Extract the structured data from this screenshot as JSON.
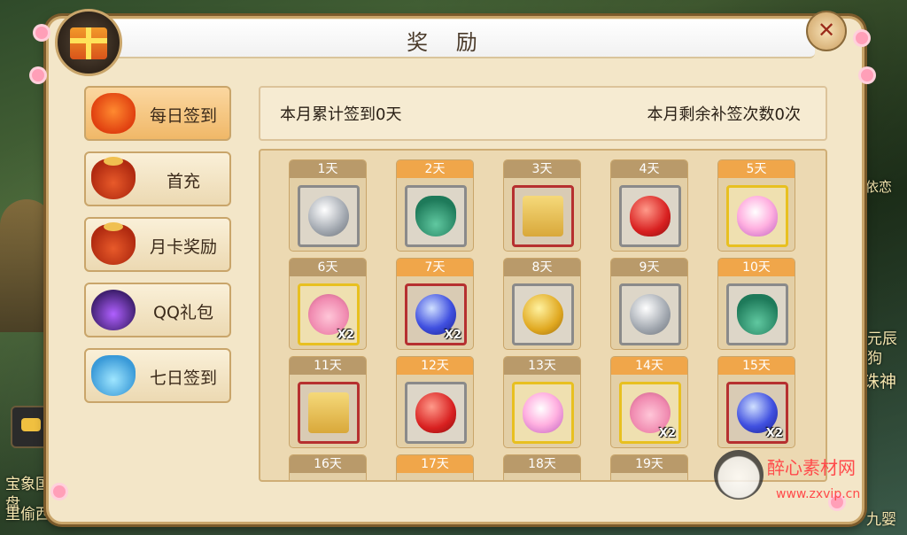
{
  "panel": {
    "title": "奖 励",
    "close_icon": "close-x-icon"
  },
  "tabs": [
    {
      "label": "每日签到",
      "icon": "red-envelope-icon",
      "active": true
    },
    {
      "label": "首充",
      "icon": "lucky-bag-icon",
      "active": false
    },
    {
      "label": "月卡奖励",
      "icon": "lucky-bag-icon",
      "active": false
    },
    {
      "label": "QQ礼包",
      "icon": "qq-gift-icon",
      "active": false
    },
    {
      "label": "七日签到",
      "icon": "blue-bag-icon",
      "active": false
    }
  ],
  "info": {
    "cumulative": "本月累计签到0天",
    "makeup_remaining": "本月剩余补签次数0次"
  },
  "days": [
    {
      "label": "1天",
      "item": "silver-coin-icon",
      "frame": "gray",
      "qty": "",
      "highlight": false
    },
    {
      "label": "2天",
      "item": "jade-leaf-icon",
      "frame": "gray",
      "qty": "",
      "highlight": true
    },
    {
      "label": "3天",
      "item": "scroll-icon",
      "frame": "red",
      "qty": "",
      "highlight": false
    },
    {
      "label": "4天",
      "item": "red-gem-icon",
      "frame": "gray",
      "qty": "",
      "highlight": false
    },
    {
      "label": "5天",
      "item": "pet-egg-icon",
      "frame": "yellow",
      "qty": "",
      "highlight": true
    },
    {
      "label": "6天",
      "item": "piggy-bag-icon",
      "frame": "yellow",
      "qty": "X2",
      "highlight": false
    },
    {
      "label": "7天",
      "item": "blue-orb-icon",
      "frame": "red",
      "qty": "X2",
      "highlight": true
    },
    {
      "label": "8天",
      "item": "gold-coin-icon",
      "frame": "gray",
      "qty": "",
      "highlight": false
    },
    {
      "label": "9天",
      "item": "silver-coin-icon",
      "frame": "gray",
      "qty": "",
      "highlight": false
    },
    {
      "label": "10天",
      "item": "jade-leaf-icon",
      "frame": "gray",
      "qty": "",
      "highlight": true
    },
    {
      "label": "11天",
      "item": "scroll-icon",
      "frame": "red",
      "qty": "",
      "highlight": false
    },
    {
      "label": "12天",
      "item": "red-gem-icon",
      "frame": "gray",
      "qty": "",
      "highlight": true
    },
    {
      "label": "13天",
      "item": "pet-egg-icon",
      "frame": "yellow",
      "qty": "",
      "highlight": false
    },
    {
      "label": "14天",
      "item": "piggy-bag-icon",
      "frame": "yellow",
      "qty": "X2",
      "highlight": true
    },
    {
      "label": "15天",
      "item": "blue-orb-icon",
      "frame": "red",
      "qty": "X2",
      "highlight": true
    },
    {
      "label": "16天",
      "item": "",
      "frame": "gray",
      "qty": "",
      "highlight": false
    },
    {
      "label": "17天",
      "item": "",
      "frame": "gray",
      "qty": "",
      "highlight": true
    },
    {
      "label": "18天",
      "item": "",
      "frame": "gray",
      "qty": "",
      "highlight": false
    },
    {
      "label": "19天",
      "item": "",
      "frame": "gray",
      "qty": "",
      "highlight": false
    }
  ],
  "background_texts": [
    "宝象国，盘",
    "里偷西",
    "二元辰",
    "戏狗",
    "诛神",
    "九婴",
    "蛙依恋"
  ],
  "watermark": {
    "text": "醉心素材网",
    "url": "www.zxvip.cn"
  }
}
